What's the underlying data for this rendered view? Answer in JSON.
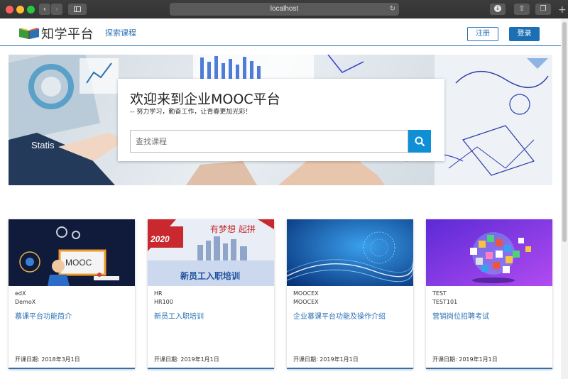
{
  "browser": {
    "url": "localhost"
  },
  "header": {
    "logo_text": "知学平台",
    "nav_explore": "探索课程",
    "register_label": "注册",
    "login_label": "登录"
  },
  "hero": {
    "title": "欢迎来到企业MOOC平台",
    "subtitle": "-- 努力学习，勤奋工作，让青春更加光彩！",
    "search_placeholder": "查找课程"
  },
  "courses": [
    {
      "org": "edX",
      "code": "DemoX",
      "title": "慕课平台功能简介",
      "start_date": "开课日期: 2018年3月1日",
      "image_text": "MOOC"
    },
    {
      "org": "HR",
      "code": "HR100",
      "title": "新员工入职培训",
      "start_date": "开课日期: 2019年1月1日",
      "image_text": "新员工入职培训",
      "image_year": "2020",
      "image_slogan": "有梦想 起拼"
    },
    {
      "org": "MOOCEX",
      "code": "MOOCEX",
      "title": "企业慕课平台功能及操作介绍",
      "start_date": "开课日期: 2019年1月1日"
    },
    {
      "org": "TEST",
      "code": "TEST101",
      "title": "营销岗位招聘考试",
      "start_date": "开课日期: 2019年1月1日"
    }
  ],
  "colors": {
    "brand": "#2a72b5",
    "login_bg": "#1d6fb5",
    "search_btn": "#0f8fd6"
  },
  "icons": {
    "search": "search-icon",
    "back": "chevron-left-icon",
    "forward": "chevron-right-icon",
    "reload": "reload-icon"
  }
}
